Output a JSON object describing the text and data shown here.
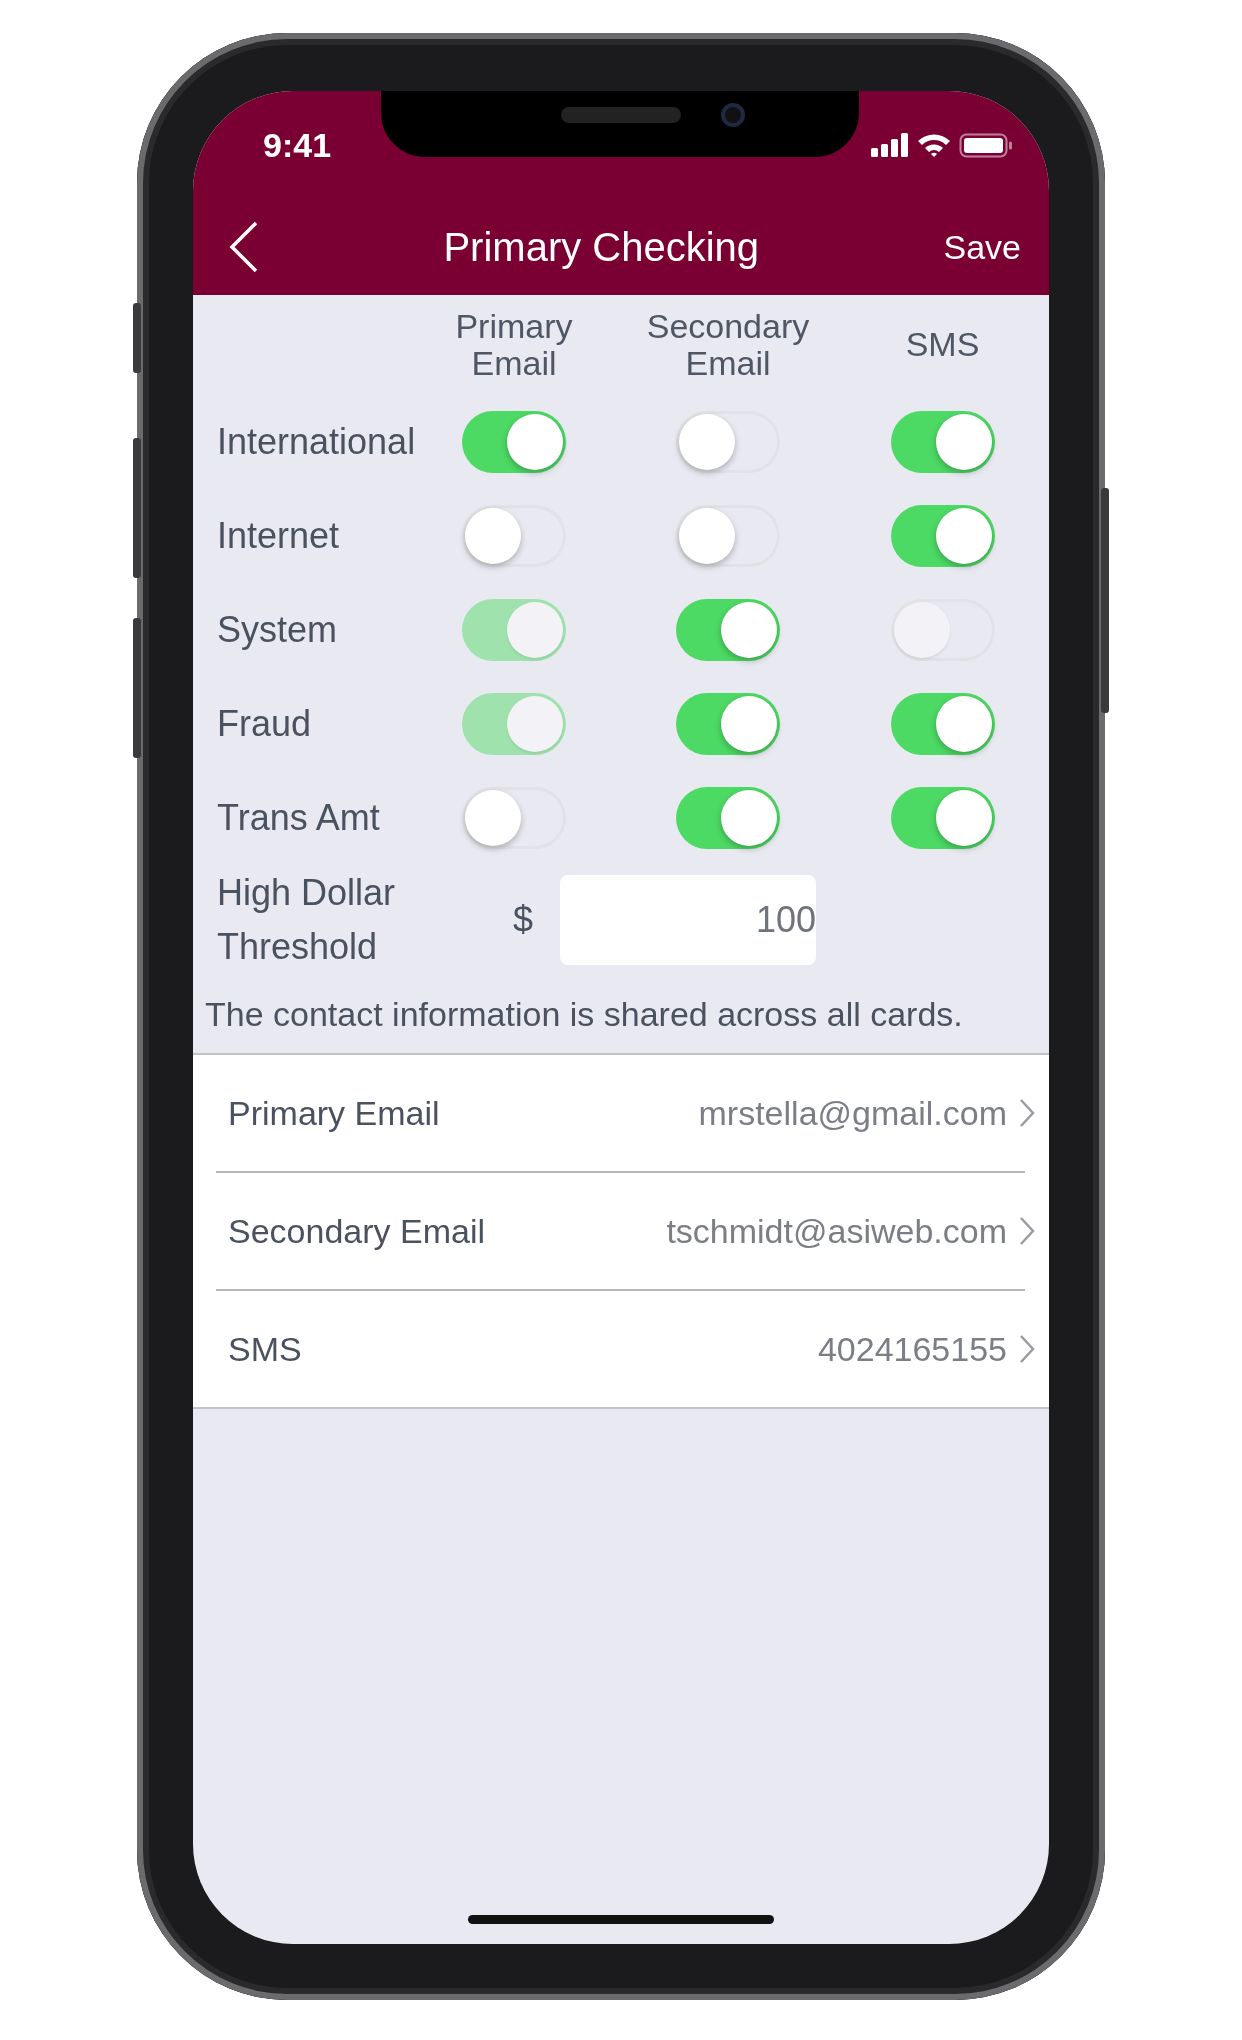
{
  "status_bar": {
    "time": "9:41"
  },
  "nav": {
    "title": "Primary Checking",
    "action": "Save"
  },
  "columns": [
    "Primary Email",
    "Secondary Email",
    "SMS"
  ],
  "alerts": [
    {
      "label": "International",
      "toggles": [
        {
          "on": true,
          "disabled": false
        },
        {
          "on": false,
          "disabled": false
        },
        {
          "on": true,
          "disabled": false
        }
      ]
    },
    {
      "label": "Internet",
      "toggles": [
        {
          "on": false,
          "disabled": false
        },
        {
          "on": false,
          "disabled": false
        },
        {
          "on": true,
          "disabled": false
        }
      ]
    },
    {
      "label": "System",
      "toggles": [
        {
          "on": true,
          "disabled": true
        },
        {
          "on": true,
          "disabled": false
        },
        {
          "on": false,
          "disabled": true
        }
      ]
    },
    {
      "label": "Fraud",
      "toggles": [
        {
          "on": true,
          "disabled": true
        },
        {
          "on": true,
          "disabled": false
        },
        {
          "on": true,
          "disabled": false
        }
      ]
    },
    {
      "label": "Trans Amt",
      "toggles": [
        {
          "on": false,
          "disabled": false
        },
        {
          "on": true,
          "disabled": false
        },
        {
          "on": true,
          "disabled": false
        }
      ]
    }
  ],
  "threshold": {
    "label": "High Dollar Threshold",
    "currency": "$",
    "value": "100"
  },
  "note": "The contact information is shared across all cards.",
  "contacts": [
    {
      "label": "Primary Email",
      "value": "mrstella@gmail.com"
    },
    {
      "label": "Secondary Email",
      "value": "tschmidt@asiweb.com"
    },
    {
      "label": "SMS",
      "value": "4024165155"
    }
  ]
}
